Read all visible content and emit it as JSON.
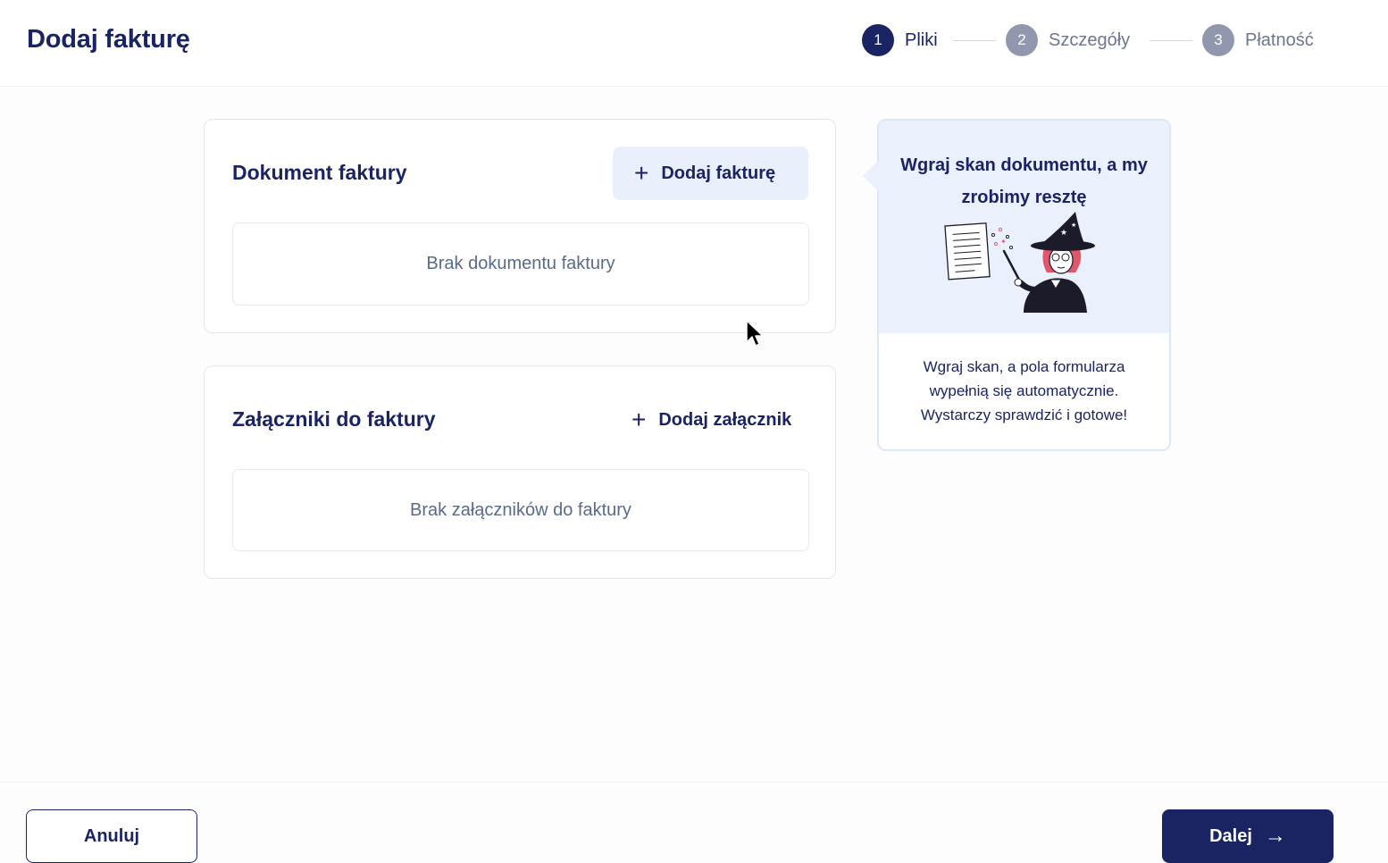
{
  "header": {
    "title": "Dodaj fakturę",
    "steps": [
      {
        "number": "1",
        "label": "Pliki",
        "state": "active"
      },
      {
        "number": "2",
        "label": "Szczegóły",
        "state": "inactive"
      },
      {
        "number": "3",
        "label": "Płatność",
        "state": "inactive"
      }
    ]
  },
  "invoice_card": {
    "title": "Dokument faktury",
    "add_label": "Dodaj fakturę",
    "add_icon": "plus-icon",
    "empty_text": "Brak dokumentu faktury"
  },
  "attachments_card": {
    "title": "Załączniki do faktury",
    "add_label": "Dodaj załącznik",
    "add_icon": "plus-icon",
    "empty_text": "Brak załączników do faktury"
  },
  "hint": {
    "title": "Wgraj skan dokumentu, a my zrobimy resztę",
    "illustration": "wizard-with-document-illustration",
    "text": "Wgraj skan, a pola formularza wypełnią się automatycznie. Wystarczy sprawdzić i gotowe!"
  },
  "footer": {
    "cancel_label": "Anuluj",
    "next_label": "Dalej",
    "next_icon": "arrow-right-icon"
  },
  "colors": {
    "primary": "#1b2463",
    "inactive_step": "#9198ad",
    "hint_bg": "#eaf0fc",
    "add_button_bg": "#e9effb"
  }
}
